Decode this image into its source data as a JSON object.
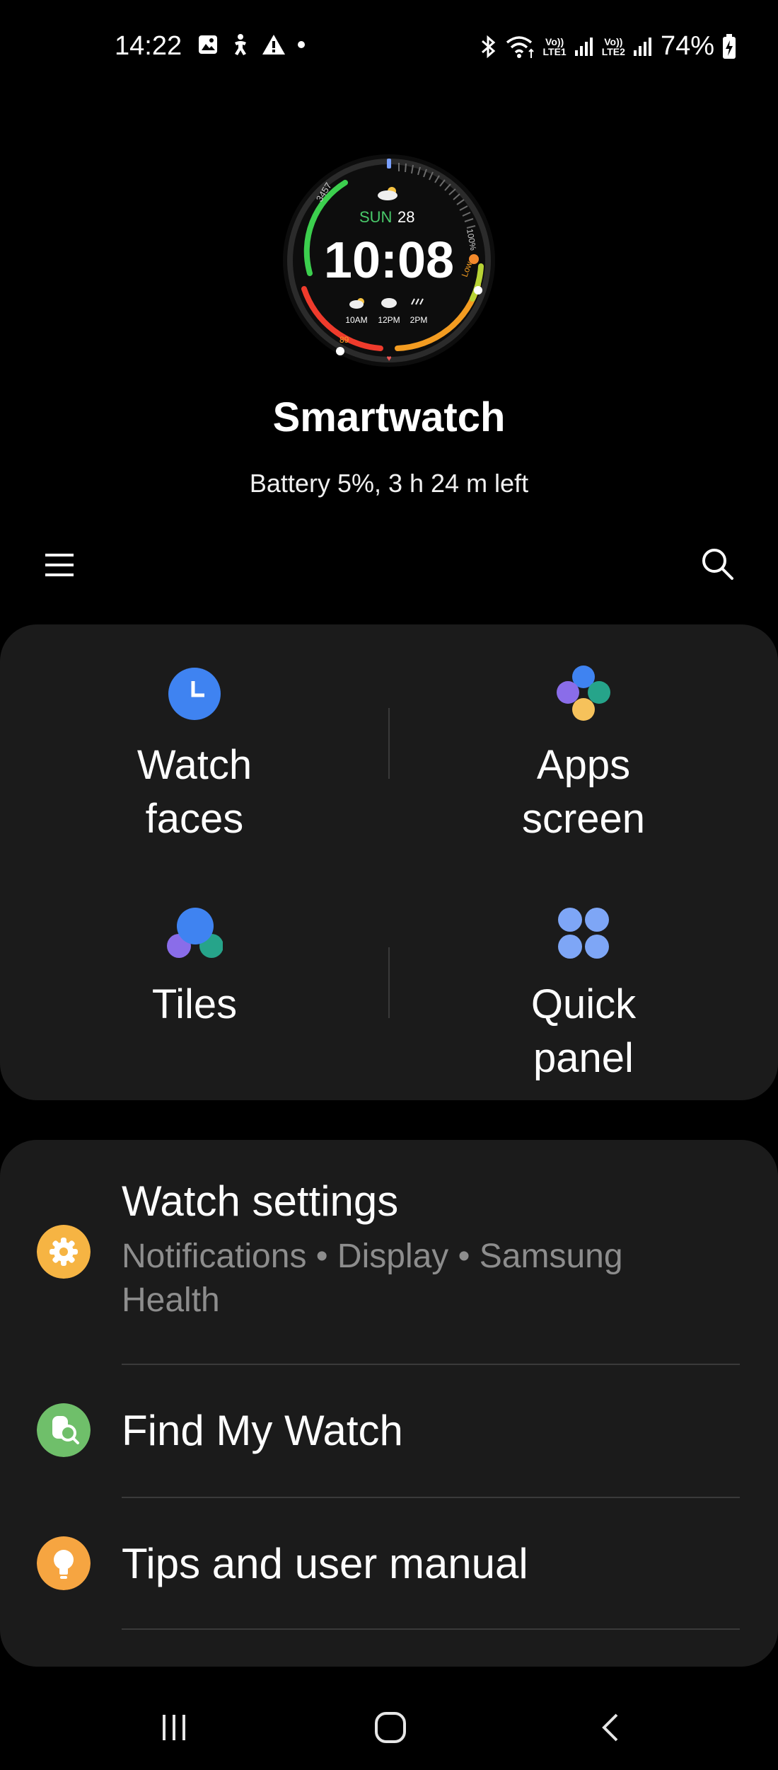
{
  "status_bar": {
    "time": "14:22",
    "left_icons": [
      "gallery-icon",
      "accessibility-icon",
      "warning-icon",
      "dot-icon"
    ],
    "right_icons": [
      "bluetooth-icon",
      "wifi-icon",
      "signal-lte1-icon",
      "signal-lte2-icon",
      "battery-charging-icon"
    ],
    "lte1_top": "Vo))",
    "lte1_bottom": "LTE1",
    "lte2_top": "Vo))",
    "lte2_bottom": "LTE2",
    "battery": "74%"
  },
  "watch_face": {
    "date_day": "SUN",
    "date_num": "28",
    "time": "10:08",
    "steps": "3457",
    "percent": "100%",
    "low_label": "Low",
    "heart": "89",
    "forecast": [
      "10AM",
      "12PM",
      "2PM"
    ]
  },
  "header": {
    "device_name": "Smartwatch",
    "battery_text": "Battery 5%, 3 h 24 m left"
  },
  "toolbar": {
    "menu_icon": "hamburger-menu-icon",
    "search_icon": "search-icon"
  },
  "grid": {
    "items": [
      {
        "label_line1": "Watch",
        "label_line2": "faces",
        "icon": "watch-faces-icon"
      },
      {
        "label_line1": "Apps",
        "label_line2": "screen",
        "icon": "apps-screen-icon"
      },
      {
        "label_line1": "Tiles",
        "label_line2": "",
        "icon": "tiles-icon"
      },
      {
        "label_line1": "Quick",
        "label_line2": "panel",
        "icon": "quick-panel-icon"
      }
    ]
  },
  "list": {
    "items": [
      {
        "title": "Watch settings",
        "subtitle": "Notifications • Display • Samsung Health",
        "icon": "gear-icon",
        "color": "#f6b443"
      },
      {
        "title": "Find My Watch",
        "subtitle": "",
        "icon": "find-watch-icon",
        "color": "#6fbf6a"
      },
      {
        "title": "Tips and user manual",
        "subtitle": "",
        "icon": "lightbulb-icon",
        "color": "#f6a541"
      }
    ]
  },
  "nav_bar": {
    "icons": [
      "recents-icon",
      "home-icon",
      "back-icon"
    ]
  },
  "colors": {
    "background": "#000000",
    "card": "#1b1b1b",
    "secondary_text": "#8d8d8d",
    "blue_accent": "#3f83f1"
  }
}
